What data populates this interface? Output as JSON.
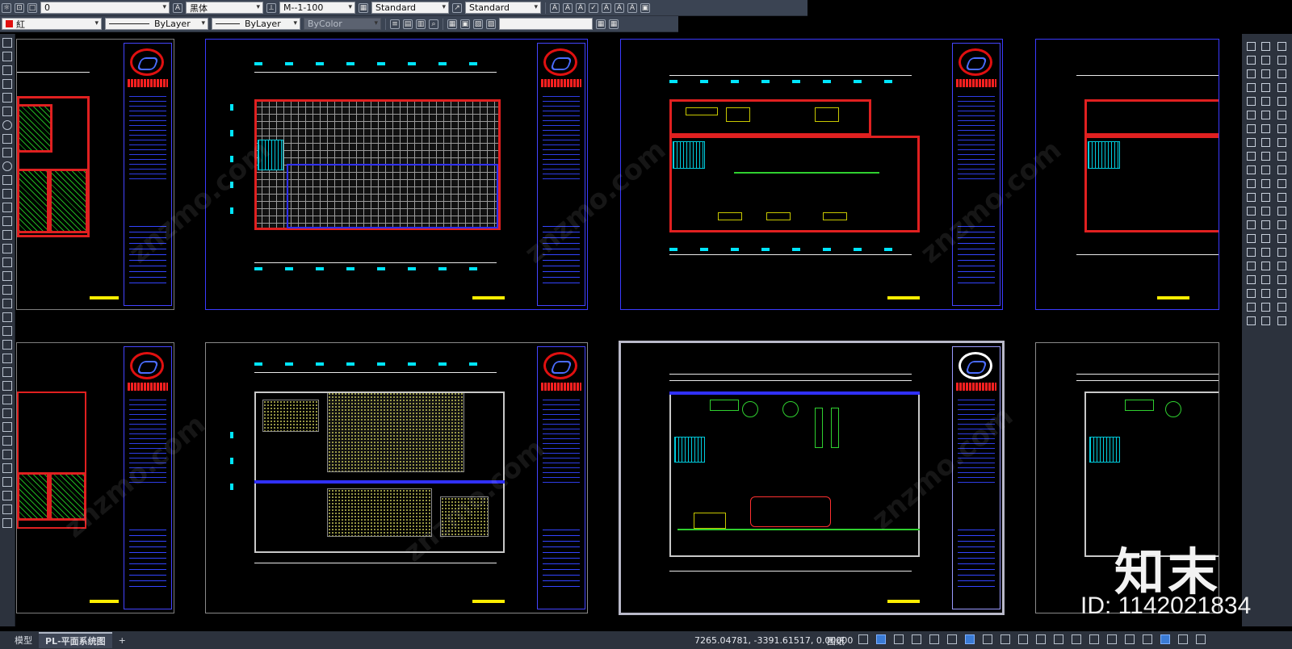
{
  "toolbar1": {
    "layer_name": "0",
    "text_style_font": "黑体",
    "dim_style": "M--1-100",
    "table_style": "Standard",
    "multileader_style": "Standard"
  },
  "toolbar2": {
    "color": "紅",
    "linetype": "ByLayer",
    "lineweight": "ByLayer",
    "plotstyle": "ByColor"
  },
  "colors": {
    "ui_bg": "#3b4453",
    "canvas": "#000000",
    "wall_red": "#e02020",
    "wall_blue": "#3030ff",
    "dim_cyan": "#00e5ff",
    "dim_yellow": "#ffee00"
  },
  "tabs": {
    "model": "模型",
    "layout": "PL-平面系统图",
    "add": "+"
  },
  "status": {
    "coordinates": "7265.04781, -3391.61517, 0.00000",
    "mode_label": "图纸"
  },
  "overlay": {
    "brand": "知末",
    "id_text": "ID: 1142021834"
  }
}
